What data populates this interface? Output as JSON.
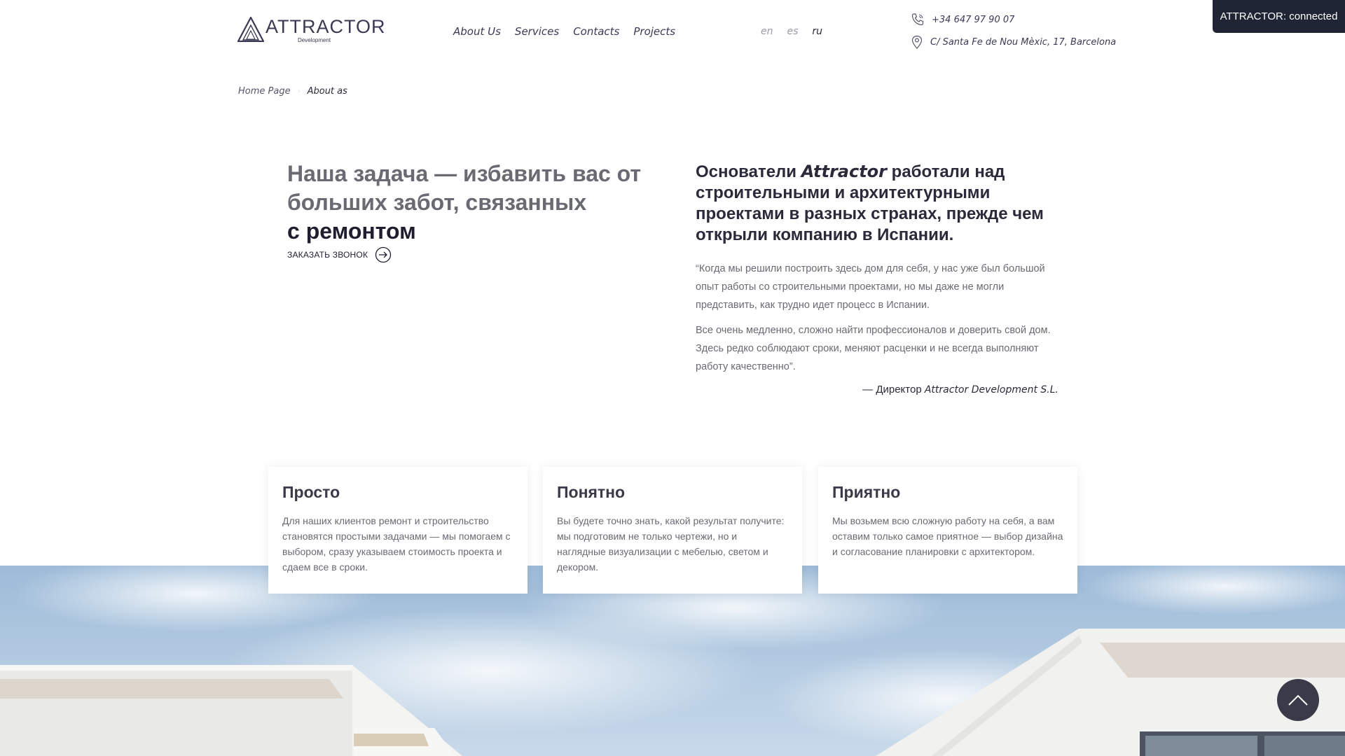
{
  "brand": {
    "name": "ATTRACTOR",
    "sub": "Development"
  },
  "nav": [
    "About Us",
    "Services",
    "Contacts",
    "Projects"
  ],
  "langs": [
    {
      "code": "en",
      "active": false
    },
    {
      "code": "es",
      "active": false
    },
    {
      "code": "ru",
      "active": true
    }
  ],
  "contact": {
    "phone": "+34 647 97 90 07",
    "address": "C/ Santa Fe de Nou Mèxic, 17, Barcelona"
  },
  "toast": "ATTRACTOR: connected",
  "breadcrumb": {
    "home": "Home Page",
    "current": "About as"
  },
  "hero": {
    "title_light": "Наша задача — избавить вас от больших забот, связанных",
    "title_strong": "с ремонтом",
    "cta": "ЗАКАЗАТЬ ЗВОНОК"
  },
  "about": {
    "title_pre": "Основатели ",
    "title_brand": "Attractor",
    "title_post": " работали над строительными и архитектурными проектами в разных странах, прежде чем открыли компанию в Испании.",
    "quote_1": "“Когда мы решили построить здесь дом для себя, у нас уже был большой опыт работы со строительными проектами, но мы даже не могли представить, как трудно идет процесс в Испании.",
    "quote_2": "Все очень медленно, сложно найти профессионалов и доверить свой дом. Здесь редко соблюдают сроки, меняют расценки и не всегда выполняют работу качественно”.",
    "signature_pre": "— Директор ",
    "signature_company": "Attractor Development S.L."
  },
  "cards": [
    {
      "title": "Просто",
      "text": "Для наших клиентов ремонт и строительство становятся простыми задачами — мы помогаем с выбором, сразу указываем стоимость проекта и сдаем все в сроки."
    },
    {
      "title": "Понятно",
      "text": "Вы будете точно знать, какой результат получите: мы подготовим не только чертежи, но и наглядные визуализации с мебелью, светом и декором."
    },
    {
      "title": "Приятно",
      "text": "Мы возьмем всю сложную работу на себя, а вам оставим только самое приятное — выбор дизайна и согласование планировки с архитектором."
    }
  ],
  "colors": {
    "primary": "#3a3a55",
    "dark": "#1e1e30",
    "toast_bg": "#1f2535",
    "muted": "#6a6a72"
  }
}
